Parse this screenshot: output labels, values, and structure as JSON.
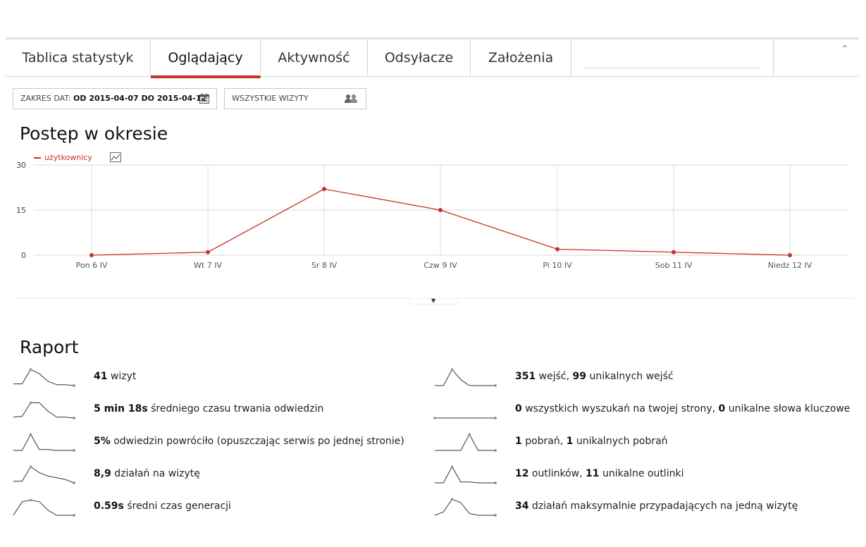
{
  "tabs": [
    {
      "label": "Tablica statystyk"
    },
    {
      "label": "Oglądający"
    },
    {
      "label": "Aktywność"
    },
    {
      "label": "Odsyłacze"
    },
    {
      "label": "Założenia"
    }
  ],
  "collapse_icon": "chevron-up-icon",
  "filters": {
    "date_prefix": "ZAKRES DAT:",
    "date_value": "OD 2015-04-07 DO 2015-04-12",
    "segment_label": "WSZYSTKIE WIZYTY"
  },
  "evolution": {
    "title": "Postęp w okresie",
    "legend_label": "użytkownicy"
  },
  "chart_data": {
    "type": "line",
    "categories": [
      "Pon 6 IV",
      "Wt 7 IV",
      "Sr 8 IV",
      "Czw 9 IV",
      "Pi 10 IV",
      "Sob 11 IV",
      "Niedz 12 IV"
    ],
    "series": [
      {
        "name": "użytkownicy",
        "values": [
          0,
          1,
          22,
          15,
          2,
          1,
          0
        ]
      }
    ],
    "ylim": [
      0,
      30
    ],
    "yticks": [
      "0",
      "15",
      "30"
    ],
    "grid": true,
    "legend": "top-left",
    "color": "#c6322a"
  },
  "report": {
    "title": "Raport",
    "left": [
      {
        "bold1": "41",
        "text1": " wizyt",
        "bold2": "",
        "text2": "",
        "spark": [
          0.1,
          0.1,
          0.95,
          0.7,
          0.25,
          0.05,
          0.05,
          0.0
        ]
      },
      {
        "bold1": "5 min 18s",
        "text1": " średniego czasu trwania odwiedzin",
        "bold2": "",
        "text2": "",
        "spark": [
          0.05,
          0.1,
          0.9,
          0.9,
          0.4,
          0.05,
          0.05,
          0.0
        ]
      },
      {
        "bold1": "5%",
        "text1": " odwiedzin powróciło (opuszczając serwis po jednej stronie)",
        "bold2": "",
        "text2": "",
        "spark": [
          0.0,
          0.0,
          0.95,
          0.05,
          0.05,
          0.0,
          0.0,
          0.0
        ]
      },
      {
        "bold1": "8,9",
        "text1": " działań na wizytę",
        "bold2": "",
        "text2": "",
        "spark": [
          0.1,
          0.1,
          0.95,
          0.6,
          0.4,
          0.3,
          0.2,
          0.0
        ]
      },
      {
        "bold1": "0.59s",
        "text1": " średni czas generacji",
        "bold2": "",
        "text2": "",
        "spark": [
          0.0,
          0.8,
          0.9,
          0.8,
          0.3,
          0.0,
          0.0,
          0.0
        ]
      }
    ],
    "right": [
      {
        "bold1": "351",
        "text1": " wejść, ",
        "bold2": "99",
        "text2": " unikalnych wejść",
        "spark": [
          0.0,
          0.0,
          0.95,
          0.35,
          0.0,
          0.0,
          0.0,
          0.0
        ]
      },
      {
        "bold1": "0",
        "text1": " wszystkich wyszukań na twojej strony, ",
        "bold2": "0",
        "text2": " unikalne słowa kluczowe",
        "spark": [
          0.0,
          0.0,
          0.0,
          0.0,
          0.0,
          0.0,
          0.0,
          0.0
        ]
      },
      {
        "bold1": "1",
        "text1": " pobrań, ",
        "bold2": "1",
        "text2": " unikalnych pobrań",
        "spark": [
          0.0,
          0.0,
          0.0,
          0.0,
          0.95,
          0.0,
          0.0,
          0.0
        ]
      },
      {
        "bold1": "12",
        "text1": " outlinków, ",
        "bold2": "11",
        "text2": " unikalne outlinki",
        "spark": [
          0.0,
          0.0,
          0.95,
          0.05,
          0.05,
          0.0,
          0.0,
          0.0
        ]
      },
      {
        "bold1": "34",
        "text1": " działań maksymalnie przypadających na jedną wizytę",
        "bold2": "",
        "text2": "",
        "spark": [
          0.0,
          0.2,
          0.95,
          0.75,
          0.1,
          0.0,
          0.0,
          0.0
        ]
      }
    ]
  }
}
